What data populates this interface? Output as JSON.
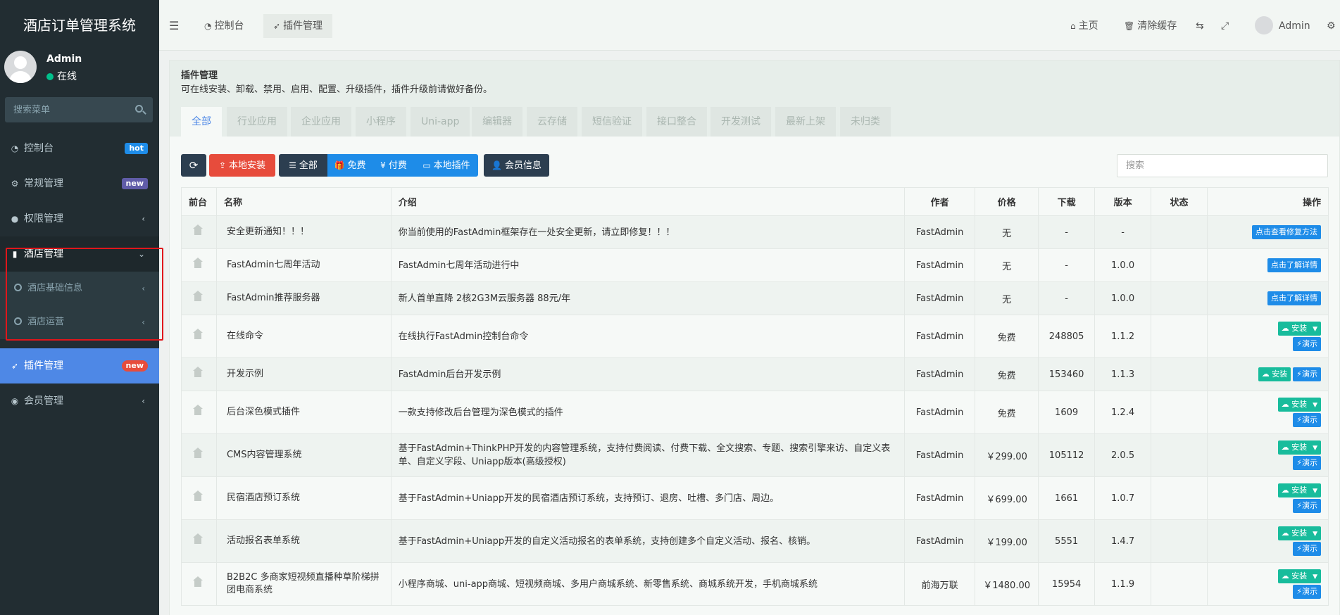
{
  "sidebar": {
    "brand": "酒店订单管理系统",
    "user": {
      "name": "Admin",
      "status": "在线"
    },
    "search_placeholder": "搜索菜单",
    "items": [
      {
        "label": "控制台",
        "icon": "dashboard-icon",
        "badge": "hot",
        "badge_color": "#1e8ce8"
      },
      {
        "label": "常规管理",
        "icon": "cogs-icon",
        "badge": "new",
        "badge_color": "#605ca8"
      },
      {
        "label": "权限管理",
        "icon": "group-icon",
        "chevron": "‹"
      },
      {
        "label": "酒店管理",
        "icon": "building-icon",
        "chevron": "⌄"
      },
      {
        "label": "插件管理",
        "icon": "rocket-icon",
        "badge": "new",
        "badge_color": "#e74c3c"
      },
      {
        "label": "会员管理",
        "icon": "user-circle-icon",
        "chevron": "‹"
      }
    ],
    "subitems": [
      {
        "label": "酒店基础信息",
        "chevron": "‹"
      },
      {
        "label": "酒店运营",
        "chevron": "‹"
      }
    ]
  },
  "topnav": {
    "menu_icon": "☰",
    "tabs": [
      {
        "label": "控制台",
        "icon": "dashboard-icon"
      },
      {
        "label": "插件管理",
        "icon": "rocket-icon"
      }
    ],
    "right": {
      "home": "主页",
      "clear_cache": "清除缓存",
      "user": "Admin"
    }
  },
  "panel": {
    "title": "插件管理",
    "description": "可在线安装、卸载、禁用、启用、配置、升级插件，插件升级前请做好备份。",
    "categories": [
      "全部",
      "行业应用",
      "企业应用",
      "小程序",
      "Uni-app",
      "编辑器",
      "云存储",
      "短信验证",
      "接口整合",
      "开发测试",
      "最新上架",
      "未归类"
    ]
  },
  "toolbar": {
    "refresh": "⟳",
    "local_install": "本地安装",
    "all": "全部",
    "free": "免费",
    "paid": "付费",
    "local_plugins": "本地插件",
    "member_info": "会员信息",
    "search_placeholder": "搜索"
  },
  "table": {
    "headers": [
      "前台",
      "名称",
      "介绍",
      "作者",
      "价格",
      "下载",
      "版本",
      "状态",
      "操作"
    ],
    "rows": [
      {
        "name": "安全更新通知！！！",
        "intro": "你当前使用的FastAdmin框架存在一处安全更新，请立即修复！！！",
        "author": "FastAdmin",
        "price": "无",
        "price_type": "none",
        "downloads": "-",
        "version": "-",
        "action": "点击查看修复方法"
      },
      {
        "name": "FastAdmin七周年活动",
        "intro": "FastAdmin七周年活动进行中",
        "author": "FastAdmin",
        "price": "无",
        "price_type": "none",
        "downloads": "-",
        "version": "1.0.0",
        "action": "点击了解详情"
      },
      {
        "name": "FastAdmin推荐服务器",
        "intro": "新人首单直降 2核2G3M云服务器 88元/年",
        "author": "FastAdmin",
        "price": "无",
        "price_type": "none",
        "downloads": "-",
        "version": "1.0.0",
        "action": "点击了解详情"
      },
      {
        "name": "在线命令",
        "intro": "在线执行FastAdmin控制台命令",
        "author": "FastAdmin",
        "price": "免费",
        "price_type": "free",
        "downloads": "248805",
        "version": "1.1.2",
        "install": "安装",
        "demo": "演示",
        "layout": "stack"
      },
      {
        "name": "开发示例",
        "intro": "FastAdmin后台开发示例",
        "author": "FastAdmin",
        "price": "免费",
        "price_type": "free",
        "downloads": "153460",
        "version": "1.1.3",
        "install": "安装",
        "demo": "演示",
        "layout": "row"
      },
      {
        "name": "后台深色模式插件",
        "intro": "一款支持修改后台管理为深色模式的插件",
        "author": "FastAdmin",
        "price": "免费",
        "price_type": "free",
        "downloads": "1609",
        "version": "1.2.4",
        "install": "安装",
        "demo": "演示",
        "layout": "stack"
      },
      {
        "name": "CMS内容管理系统",
        "intro": "基于FastAdmin+ThinkPHP开发的内容管理系统，支持付费阅读、付费下载、全文搜索、专题、搜索引擎来访、自定义表单、自定义字段、Uniapp版本(高级授权)",
        "author": "FastAdmin",
        "price": "￥299.00",
        "price_type": "paid",
        "downloads": "105112",
        "version": "2.0.5",
        "install": "安装",
        "demo": "演示",
        "layout": "stack"
      },
      {
        "name": "民宿酒店预订系统",
        "intro": "基于FastAdmin+Uniapp开发的民宿酒店预订系统，支持预订、退房、吐槽、多门店、周边。",
        "author": "FastAdmin",
        "price": "￥699.00",
        "price_type": "paid",
        "downloads": "1661",
        "version": "1.0.7",
        "install": "安装",
        "demo": "演示",
        "layout": "stack"
      },
      {
        "name": "活动报名表单系统",
        "intro": "基于FastAdmin+Uniapp开发的自定义活动报名的表单系统，支持创建多个自定义活动、报名、核销。",
        "author": "FastAdmin",
        "price": "￥199.00",
        "price_type": "paid",
        "downloads": "5551",
        "version": "1.4.7",
        "install": "安装",
        "demo": "演示",
        "layout": "stack"
      },
      {
        "name": "B2B2C 多商家短视频直播种草阶梯拼团电商系统",
        "intro": "小程序商城、uni-app商城、短视频商城、多用户商城系统、新零售系统、商城系统开发，手机商城系统",
        "author": "前海万联",
        "price": "￥1480.00",
        "price_type": "paid",
        "downloads": "15954",
        "version": "1.1.9",
        "install": "安装",
        "demo": "演示",
        "layout": "stack"
      }
    ]
  }
}
